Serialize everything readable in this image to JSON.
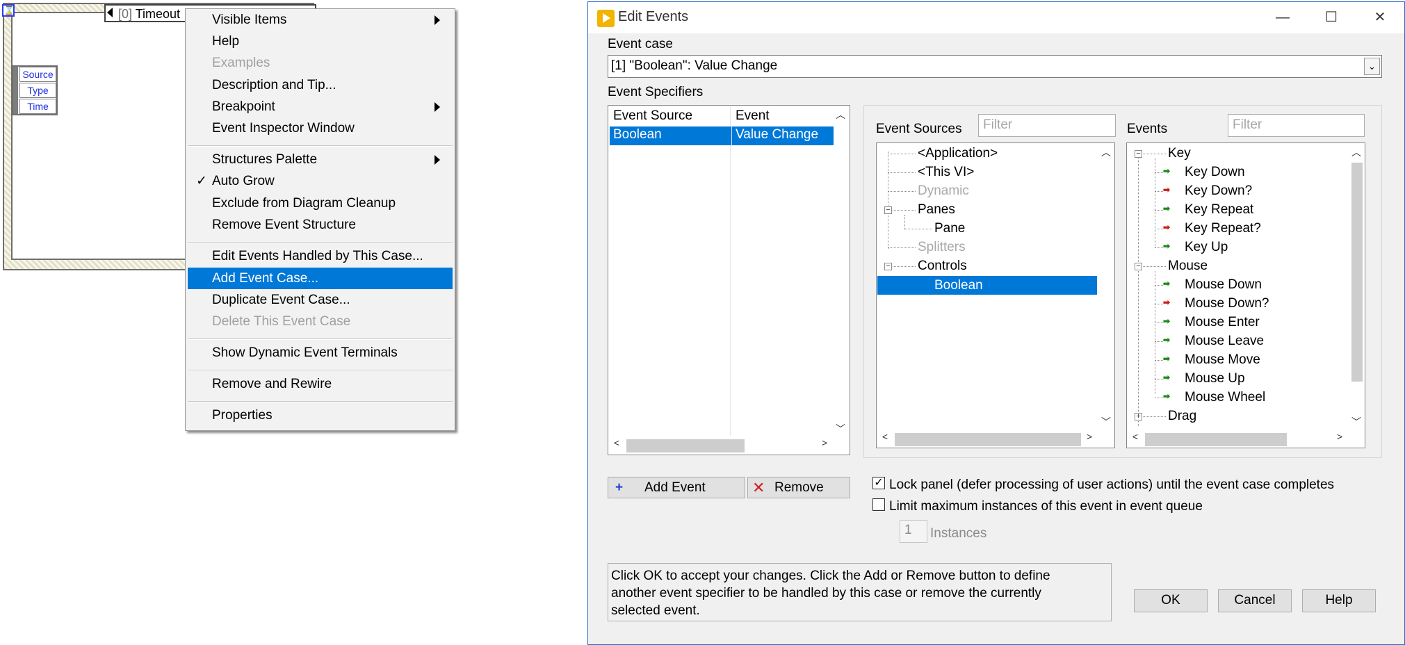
{
  "event_structure": {
    "hourglass_icon": "⌛",
    "selector_index": "[0]",
    "selector_label": "Timeout",
    "data_node": [
      "Source",
      "Type",
      "Time"
    ]
  },
  "context_menu": {
    "items": [
      {
        "label": "Visible Items",
        "submenu": true
      },
      {
        "label": "Help"
      },
      {
        "label": "Examples",
        "disabled": true
      },
      {
        "label": "Description and Tip..."
      },
      {
        "label": "Breakpoint",
        "submenu": true
      },
      {
        "label": "Event Inspector Window"
      },
      {
        "label": "Structures Palette",
        "submenu": true
      },
      {
        "label": "Auto Grow",
        "checked": true
      },
      {
        "label": "Exclude from Diagram Cleanup"
      },
      {
        "label": "Remove Event Structure"
      },
      {
        "label": "Edit Events Handled by This Case..."
      },
      {
        "label": "Add Event Case...",
        "highlighted": true
      },
      {
        "label": "Duplicate Event Case..."
      },
      {
        "label": "Delete This Event Case",
        "disabled": true
      },
      {
        "label": "Show Dynamic Event Terminals"
      },
      {
        "label": "Remove and Rewire"
      },
      {
        "label": "Properties"
      }
    ],
    "check_mark": "✓"
  },
  "dialog": {
    "title": "Edit Events",
    "window_buttons": {
      "minimize": "—",
      "maximize": "☐",
      "close": "✕"
    },
    "event_case_label": "Event case",
    "event_case_value": "[1] \"Boolean\": Value Change",
    "combo_arrow": "⌄",
    "event_specifiers_label": "Event Specifiers",
    "specifiers_table": {
      "headers": [
        "Event Source",
        "Event"
      ],
      "rows": [
        [
          "Boolean",
          "Value Change"
        ]
      ]
    },
    "event_sources_label": "Event Sources",
    "events_label": "Events",
    "filter_placeholder": "Filter",
    "sources_tree": [
      {
        "label": "<Application>",
        "disabled": false
      },
      {
        "label": "<This VI>",
        "disabled": false
      },
      {
        "label": "Dynamic",
        "disabled": true
      },
      {
        "label": "Panes",
        "disabled": false
      },
      {
        "label": "Pane",
        "disabled": false
      },
      {
        "label": "Splitters",
        "disabled": true
      },
      {
        "label": "Controls",
        "disabled": false
      },
      {
        "label": "Boolean",
        "disabled": false,
        "selected": true
      }
    ],
    "events_tree": [
      {
        "label": "Key",
        "group": true
      },
      {
        "label": "Key Down",
        "filter": false
      },
      {
        "label": "Key Down?",
        "filter": true
      },
      {
        "label": "Key Repeat",
        "filter": false
      },
      {
        "label": "Key Repeat?",
        "filter": true
      },
      {
        "label": "Key Up",
        "filter": false
      },
      {
        "label": "Mouse",
        "group": true
      },
      {
        "label": "Mouse Down",
        "filter": false
      },
      {
        "label": "Mouse Down?",
        "filter": true
      },
      {
        "label": "Mouse Enter",
        "filter": false
      },
      {
        "label": "Mouse Leave",
        "filter": false
      },
      {
        "label": "Mouse Move",
        "filter": false
      },
      {
        "label": "Mouse Up",
        "filter": false
      },
      {
        "label": "Mouse Wheel",
        "filter": false
      },
      {
        "label": "Drag",
        "group": true,
        "collapsed": true
      }
    ],
    "event_icon_glyph": "➡",
    "add_event_button": "Add Event",
    "add_icon": "+",
    "remove_button": "Remove",
    "remove_icon": "✕",
    "lock_panel_label": "Lock panel (defer processing of user actions) until the event case completes",
    "lock_panel_checked": true,
    "limit_label": "Limit maximum instances of this event in event queue",
    "limit_checked": false,
    "instances_value": "1",
    "instances_label": "Instances",
    "note_text": "Click OK to accept your changes.  Click the Add or Remove button to define\nanother event specifier to be handled by this case or remove the currently\nselected event.",
    "ok_button": "OK",
    "cancel_button": "Cancel",
    "help_button": "Help",
    "colors": {
      "selection": "#0078d7",
      "app_icon": "#f3b400",
      "node_text": "#1a2fe0"
    }
  }
}
